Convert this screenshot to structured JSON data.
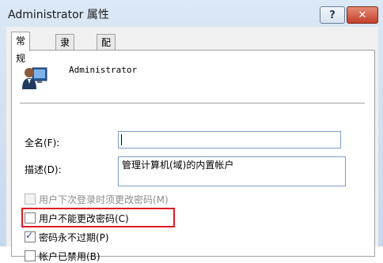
{
  "window": {
    "title": "Administrator 属性",
    "help_label": "?",
    "close_label": "✕"
  },
  "tabs": [
    {
      "label": "常规",
      "active": true
    },
    {
      "label": "隶属于",
      "active": false
    },
    {
      "label": "配置文件",
      "active": false
    }
  ],
  "user": {
    "name": "Administrator",
    "icon": "user-account-icon"
  },
  "fields": {
    "fullname_label": "全名(F):",
    "fullname_value": "",
    "description_label": "描述(D):",
    "description_value": "管理计算机(域)的内置帐户"
  },
  "options": [
    {
      "label": "用户下次登录时须更改密码(M)",
      "checked": false,
      "disabled": true
    },
    {
      "label": "用户不能更改密码(C)",
      "checked": false,
      "disabled": false,
      "highlighted": true
    },
    {
      "label": "密码永不过期(P)",
      "checked": true,
      "disabled": false
    },
    {
      "label": "帐户已禁用(B)",
      "checked": false,
      "disabled": false
    }
  ],
  "colors": {
    "highlight": "#e0171f",
    "close_button": "#c3402a"
  }
}
